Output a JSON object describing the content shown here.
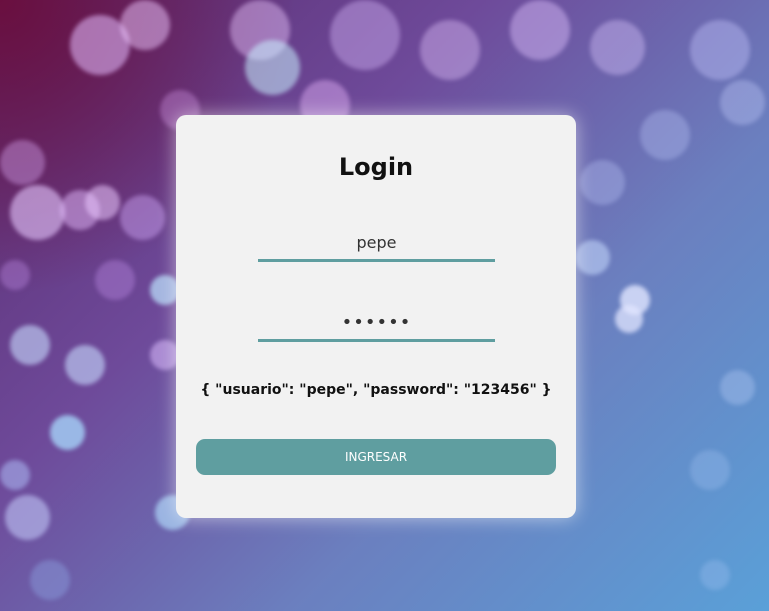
{
  "login": {
    "title": "Login",
    "username_value": "pepe",
    "password_value": "123456",
    "credentials_hint": "{ \"usuario\": \"pepe\", \"password\": \"123456\" }",
    "submit_label": "INGRESAR"
  },
  "colors": {
    "accent": "#5f9ea0",
    "card_background": "#f2f2f2"
  }
}
